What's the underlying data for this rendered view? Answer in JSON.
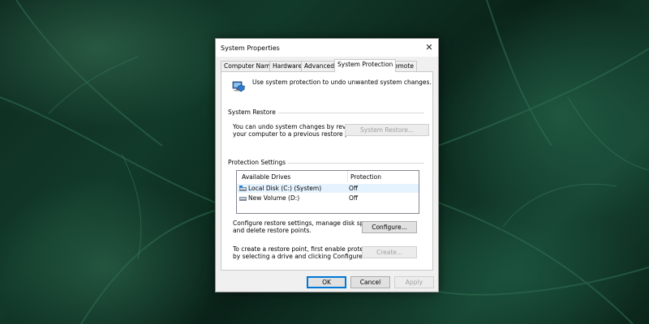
{
  "window": {
    "title": "System Properties"
  },
  "tabs": [
    {
      "label": "Computer Name"
    },
    {
      "label": "Hardware"
    },
    {
      "label": "Advanced"
    },
    {
      "label": "System Protection"
    },
    {
      "label": "Remote"
    }
  ],
  "active_tab": "System Protection",
  "intro_text": "Use system protection to undo unwanted system changes.",
  "system_restore": {
    "group_label": "System Restore",
    "description_line1": "You can undo system changes by reverting",
    "description_line2": "your computer to a previous restore point.",
    "button_label": "System Restore..."
  },
  "protection_settings": {
    "group_label": "Protection Settings",
    "columns": [
      "Available Drives",
      "Protection"
    ],
    "drives": [
      {
        "name": "Local Disk (C:) (System)",
        "protection": "Off"
      },
      {
        "name": "New Volume (D:)",
        "protection": "Off"
      }
    ],
    "configure_text_line1": "Configure restore settings, manage disk space,",
    "configure_text_line2": "and delete restore points.",
    "configure_button": "Configure...",
    "create_text_line1": "To create a restore point, first enable protection",
    "create_text_line2": "by selecting a drive and clicking Configure.",
    "create_button": "Create..."
  },
  "footer": {
    "ok": "OK",
    "cancel": "Cancel",
    "apply": "Apply"
  },
  "colors": {
    "accent": "#0078d7",
    "selected_row": "#e5f3ff"
  }
}
